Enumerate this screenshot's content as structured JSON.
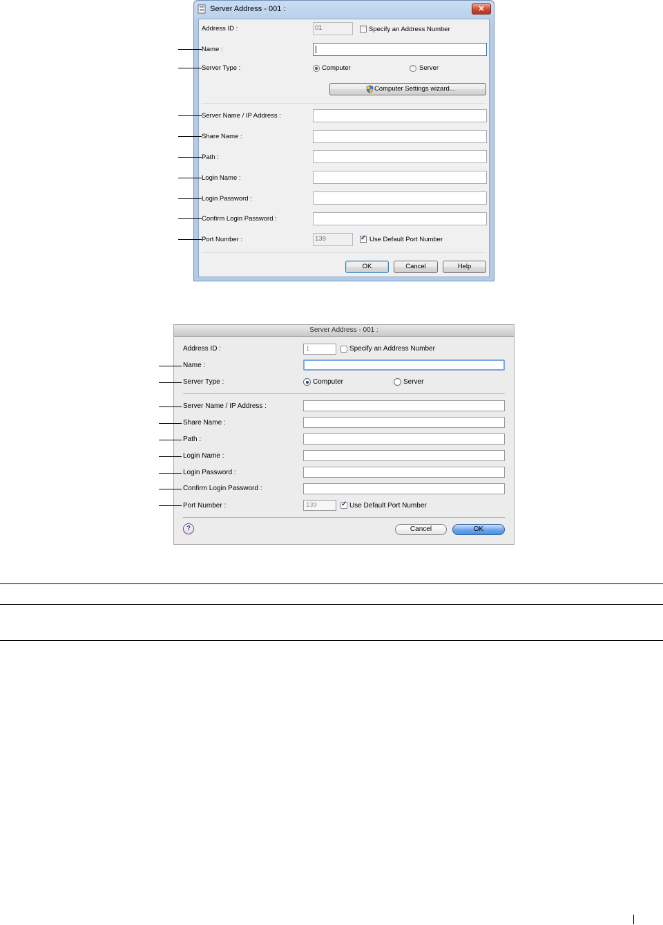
{
  "windows_dialog": {
    "title": "Server Address - 001 :",
    "close_glyph": "✕",
    "address_id": {
      "label": "Address ID :",
      "value": "01",
      "specify_label": "Specify an Address Number",
      "specify_checked": false
    },
    "name": {
      "label": "Name :",
      "value": ""
    },
    "server_type": {
      "label": "Server Type :",
      "computer_label": "Computer",
      "server_label": "Server",
      "selected": "Computer"
    },
    "wizard_button": "Computer Settings wizard...",
    "server_name": {
      "label": "Server Name / IP Address :"
    },
    "share_name": {
      "label": "Share Name :"
    },
    "path": {
      "label": "Path :"
    },
    "login_name": {
      "label": "Login Name :"
    },
    "login_password": {
      "label": "Login Password :"
    },
    "confirm_password": {
      "label": "Confirm Login Password :"
    },
    "port": {
      "label": "Port Number :",
      "value": "139",
      "default_label": "Use Default Port Number",
      "default_checked": true
    },
    "buttons": {
      "ok": "OK",
      "cancel": "Cancel",
      "help": "Help"
    }
  },
  "mac_dialog": {
    "title": "Server Address - 001 :",
    "address_id": {
      "label": "Address ID :",
      "value": "1",
      "specify_label": "Specify an Address Number",
      "specify_checked": false
    },
    "name": {
      "label": "Name :"
    },
    "server_type": {
      "label": "Server Type :",
      "computer_label": "Computer",
      "server_label": "Server",
      "selected": "Computer"
    },
    "server_name": {
      "label": "Server Name / IP Address :"
    },
    "share_name": {
      "label": "Share Name :"
    },
    "path": {
      "label": "Path :"
    },
    "login_name": {
      "label": "Login Name :"
    },
    "login_password": {
      "label": "Login Password :"
    },
    "confirm_password": {
      "label": "Confirm Login Password :"
    },
    "port": {
      "label": "Port Number :",
      "value": "139",
      "default_label": "Use Default Port Number",
      "default_checked": true
    },
    "help_glyph": "?",
    "buttons": {
      "cancel": "Cancel",
      "ok": "OK"
    }
  }
}
